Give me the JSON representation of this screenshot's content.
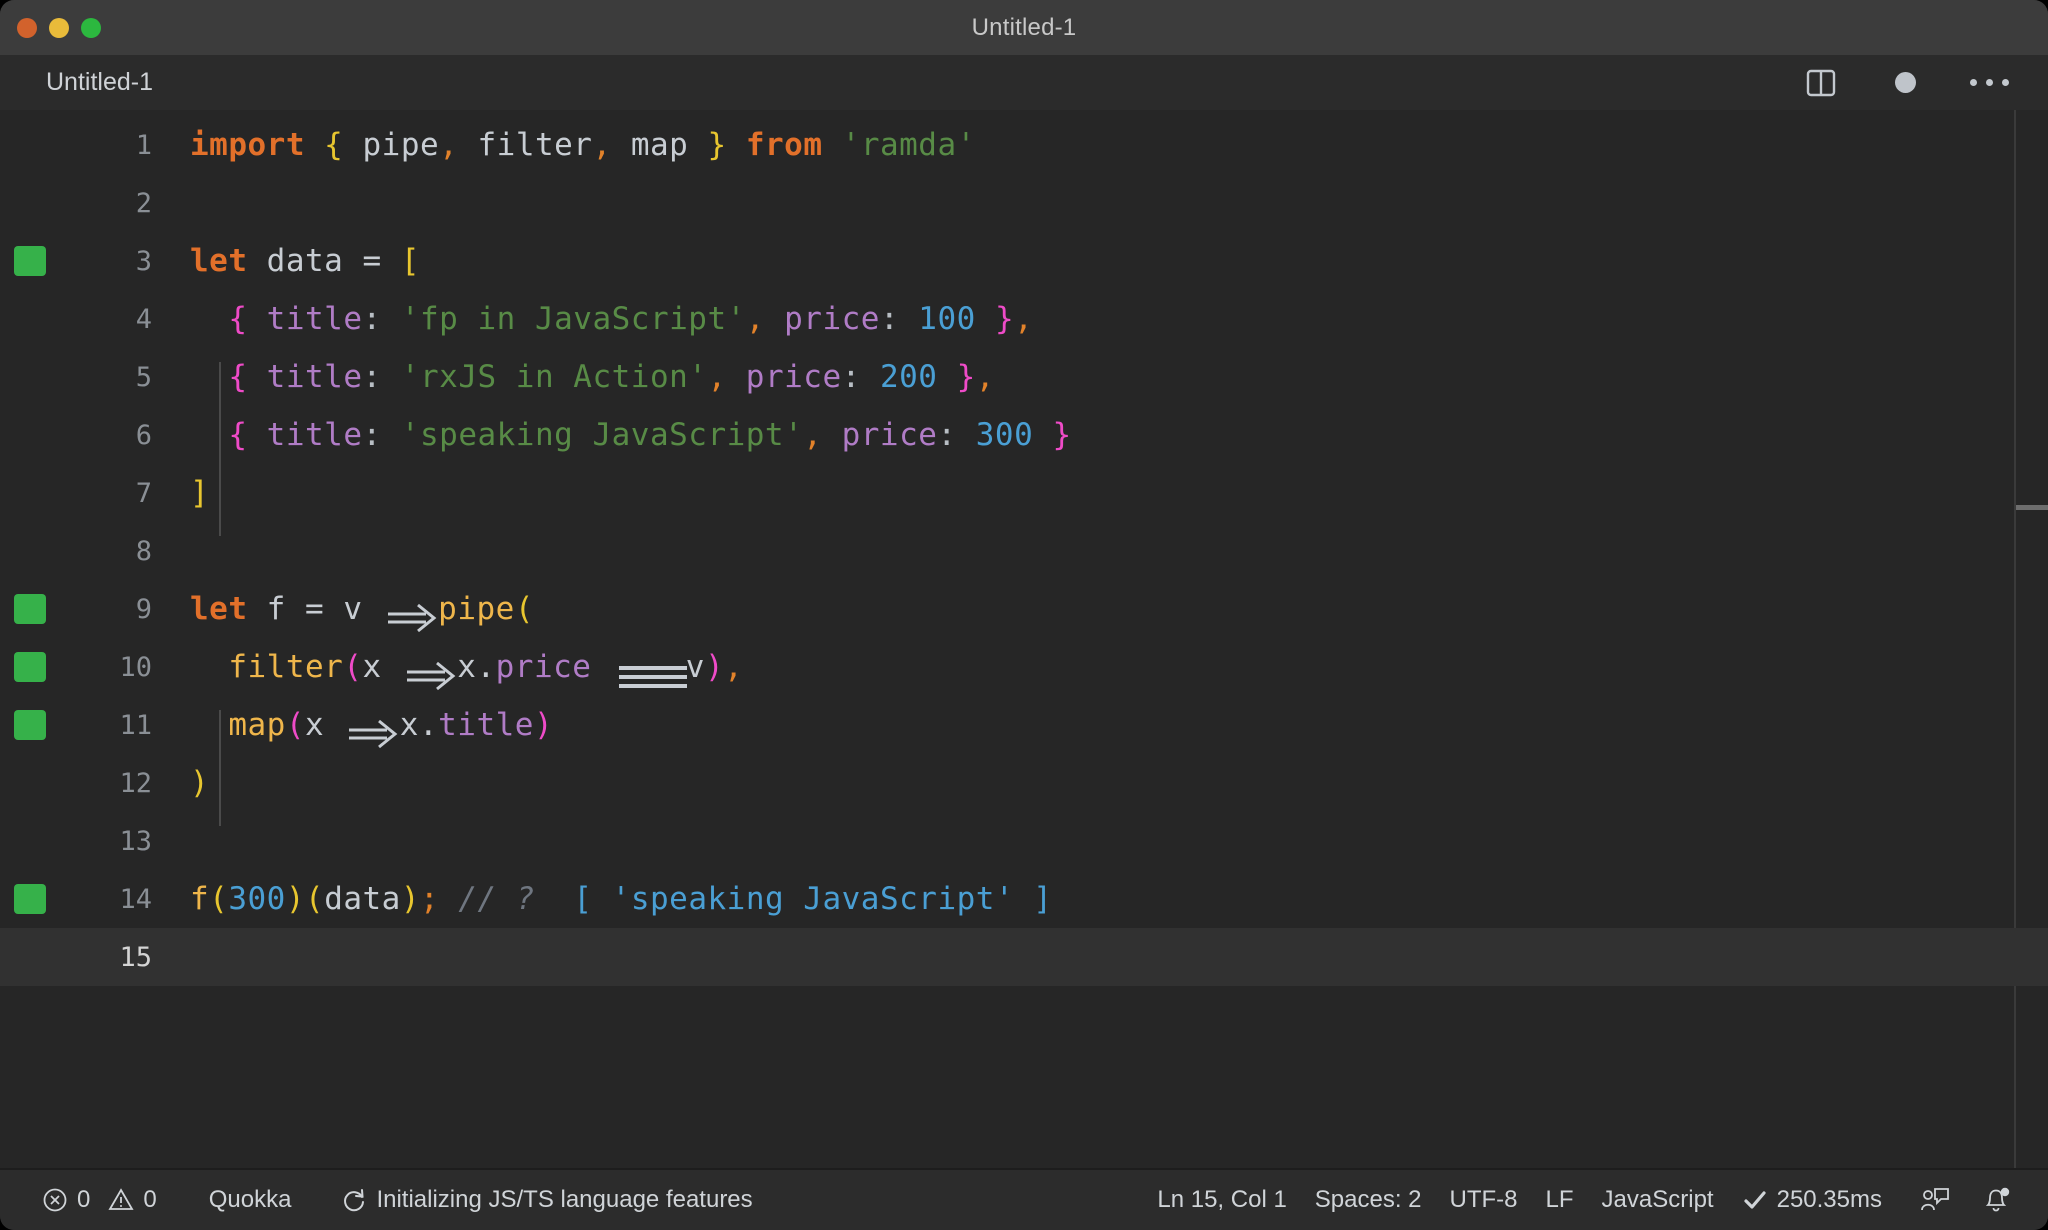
{
  "window": {
    "title": "Untitled-1",
    "traffic_lights": [
      {
        "name": "close",
        "color": "#d2622c"
      },
      {
        "name": "minimize",
        "color": "#e9bb3a"
      },
      {
        "name": "maximize",
        "color": "#2cb83f"
      }
    ]
  },
  "tabstrip": {
    "label": "Untitled-1",
    "actions": [
      {
        "name": "split-editor-icon",
        "label": "Split Editor"
      },
      {
        "name": "unsaved-dot-icon",
        "label": "Unsaved changes"
      },
      {
        "name": "more-actions-icon",
        "label": "More Actions..."
      }
    ]
  },
  "editor": {
    "language": "JavaScript",
    "indent_guide_color": "#4a4a4a",
    "coverage_color": "#36b14a",
    "current_line": 15,
    "lines": [
      {
        "n": 1,
        "covered": false
      },
      {
        "n": 2,
        "covered": false
      },
      {
        "n": 3,
        "covered": true
      },
      {
        "n": 4,
        "covered": false
      },
      {
        "n": 5,
        "covered": false
      },
      {
        "n": 6,
        "covered": false
      },
      {
        "n": 7,
        "covered": false
      },
      {
        "n": 8,
        "covered": false
      },
      {
        "n": 9,
        "covered": true
      },
      {
        "n": 10,
        "covered": true
      },
      {
        "n": 11,
        "covered": true
      },
      {
        "n": 12,
        "covered": false
      },
      {
        "n": 13,
        "covered": false
      },
      {
        "n": 14,
        "covered": true
      },
      {
        "n": 15,
        "covered": false
      }
    ],
    "source_text": [
      "import { pipe, filter, map } from 'ramda'",
      "",
      "let data = [",
      "  { title: 'fp in JavaScript', price: 100 },",
      "  { title: 'rxJS in Action', price: 200 },",
      "  { title: 'speaking JavaScript', price: 300 }",
      "]",
      "",
      "let f = v => pipe(",
      "  filter(x => x.price === v),",
      "  map(x => x.title)",
      ")",
      "",
      "f(300)(data); // ? [ 'speaking JavaScript' ]",
      ""
    ],
    "inline_result": {
      "comment": "// ?",
      "value": "[ 'speaking JavaScript' ]"
    }
  },
  "statusbar": {
    "problems": {
      "error_icon": "error-circle-icon",
      "errors": "0",
      "warning_icon": "warning-triangle-icon",
      "warnings": "0"
    },
    "quokka": "Quokka",
    "language_status": {
      "icon": "sync-spinner-icon",
      "text": "Initializing JS/TS language features"
    },
    "cursor_position": "Ln 15, Col 1",
    "indentation": "Spaces: 2",
    "encoding": "UTF-8",
    "eol": "LF",
    "language_mode": "JavaScript",
    "run_time": {
      "icon": "check-icon",
      "text": "250.35ms"
    },
    "feedback_icon": "feedback-person-icon",
    "notifications_icon": "bell-badge-icon"
  }
}
